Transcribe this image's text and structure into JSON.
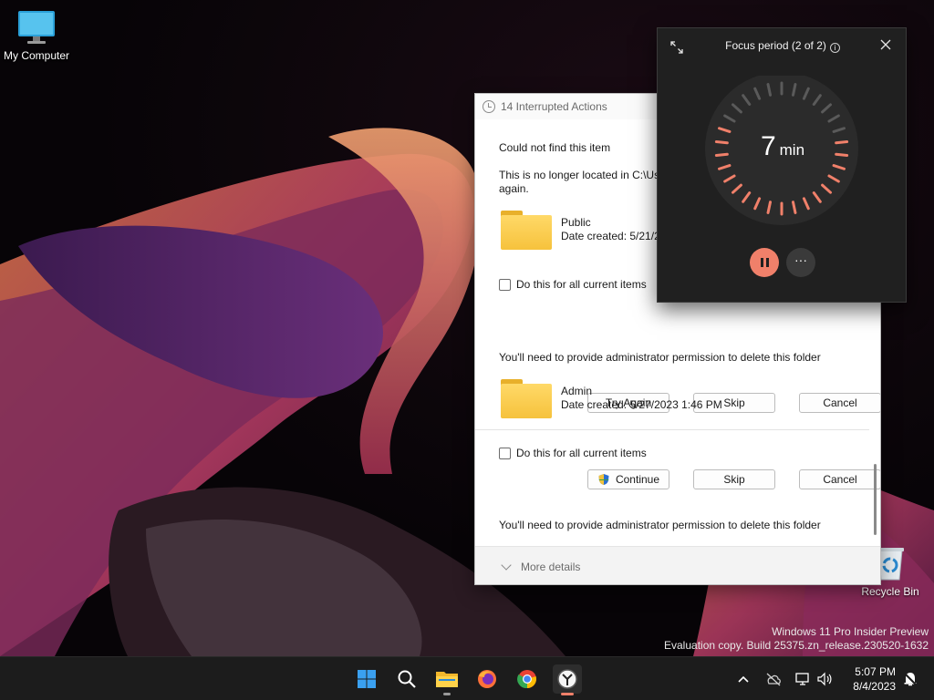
{
  "desktop": {
    "icons": [
      {
        "label": "My Computer"
      },
      {
        "label": "Recycle Bin"
      }
    ],
    "watermark": {
      "line1": "Windows 11 Pro Insider Preview",
      "line2": "Evaluation copy. Build 25375.zn_release.230520-1632"
    }
  },
  "dialog": {
    "title": "14 Interrupted Actions",
    "sections": [
      {
        "heading": "Could not find this item",
        "message": "This is no longer located in C:\\Us",
        "message_cont": "again.",
        "folder_name": "Public",
        "folder_date": "Date created: 5/21/2",
        "checkbox_label": "Do this for all current items",
        "buttons": [
          "Try Again",
          "Skip",
          "Cancel"
        ]
      },
      {
        "heading": "You'll need to provide administrator permission to delete this folder",
        "folder_name": "Admin",
        "folder_date": "Date created: 5/27/2023 1:46 PM",
        "checkbox_label": "Do this for all current items",
        "buttons": [
          "Continue",
          "Skip",
          "Cancel"
        ]
      },
      {
        "heading": "You'll need to provide administrator permission to delete this folder"
      }
    ],
    "footer": "More details"
  },
  "focus": {
    "title": "Focus period (2 of 2)",
    "value": "7",
    "unit": "min",
    "more": "···",
    "accent": "#f0806a",
    "track": "#5a5a5a"
  },
  "taskbar": {
    "apps": [
      "start-icon",
      "search-icon",
      "file-explorer-icon",
      "firefox-icon",
      "chrome-icon",
      "clock-app-icon"
    ],
    "time": "5:07 PM",
    "date": "8/4/2023"
  }
}
